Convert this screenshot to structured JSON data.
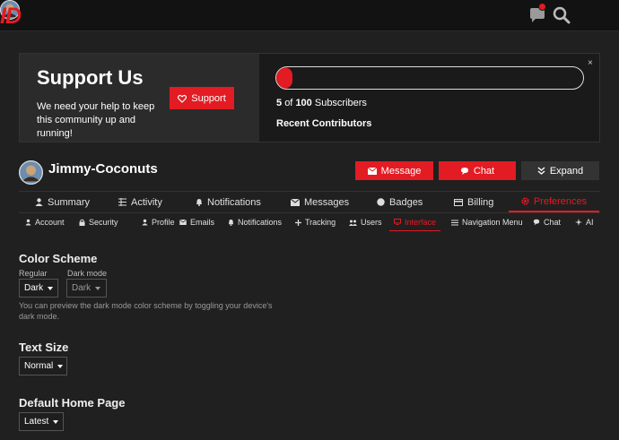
{
  "header": {
    "logo_text": "ID",
    "icons": [
      "chat-icon",
      "search-icon",
      "avatar"
    ]
  },
  "banner": {
    "title": "Support Us",
    "text": "We need your help to keep this community up and running!",
    "support_label": "Support",
    "close_label": "×",
    "progress_fraction": 0.05,
    "subscribers_current": "5",
    "subscribers_of": "of",
    "subscribers_total": "100",
    "subscribers_label": "Subscribers",
    "recent_label": "Recent Contributors"
  },
  "user": {
    "name": "Jimmy-Coconuts",
    "message_label": "Message",
    "chat_label": "Chat",
    "expand_label": "Expand"
  },
  "nav_primary": [
    {
      "label": "Summary",
      "icon": "user-icon"
    },
    {
      "label": "Activity",
      "icon": "list-icon"
    },
    {
      "label": "Notifications",
      "icon": "bell-icon"
    },
    {
      "label": "Messages",
      "icon": "envelope-icon"
    },
    {
      "label": "Badges",
      "icon": "badge-icon"
    },
    {
      "label": "Billing",
      "icon": "card-icon"
    },
    {
      "label": "Preferences",
      "icon": "gear-icon",
      "active": true
    }
  ],
  "nav_secondary": [
    {
      "label": "Account",
      "icon": "user-icon"
    },
    {
      "label": "Security",
      "icon": "lock-icon"
    },
    {
      "label": "Profile",
      "icon": "user-icon"
    },
    {
      "label": "Emails",
      "icon": "envelope-icon"
    },
    {
      "label": "Notifications",
      "icon": "bell-icon"
    },
    {
      "label": "Tracking",
      "icon": "plus-icon"
    },
    {
      "label": "Users",
      "icon": "users-icon"
    },
    {
      "label": "Interface",
      "icon": "monitor-icon",
      "active": true
    },
    {
      "label": "Navigation Menu",
      "icon": "bars-icon"
    },
    {
      "label": "Chat",
      "icon": "chat-icon"
    },
    {
      "label": "AI",
      "icon": "sparkle-icon"
    }
  ],
  "settings": {
    "color_scheme": {
      "title": "Color Scheme",
      "regular_label": "Regular",
      "regular_value": "Dark",
      "dark_label": "Dark mode",
      "dark_value": "Dark",
      "help": "You can preview the dark mode color scheme by toggling your device's dark mode."
    },
    "text_size": {
      "title": "Text Size",
      "value": "Normal"
    },
    "home_page": {
      "title": "Default Home Page",
      "value": "Latest"
    }
  },
  "colors": {
    "accent": "#e31b23",
    "background": "#202020",
    "header": "#121212"
  }
}
